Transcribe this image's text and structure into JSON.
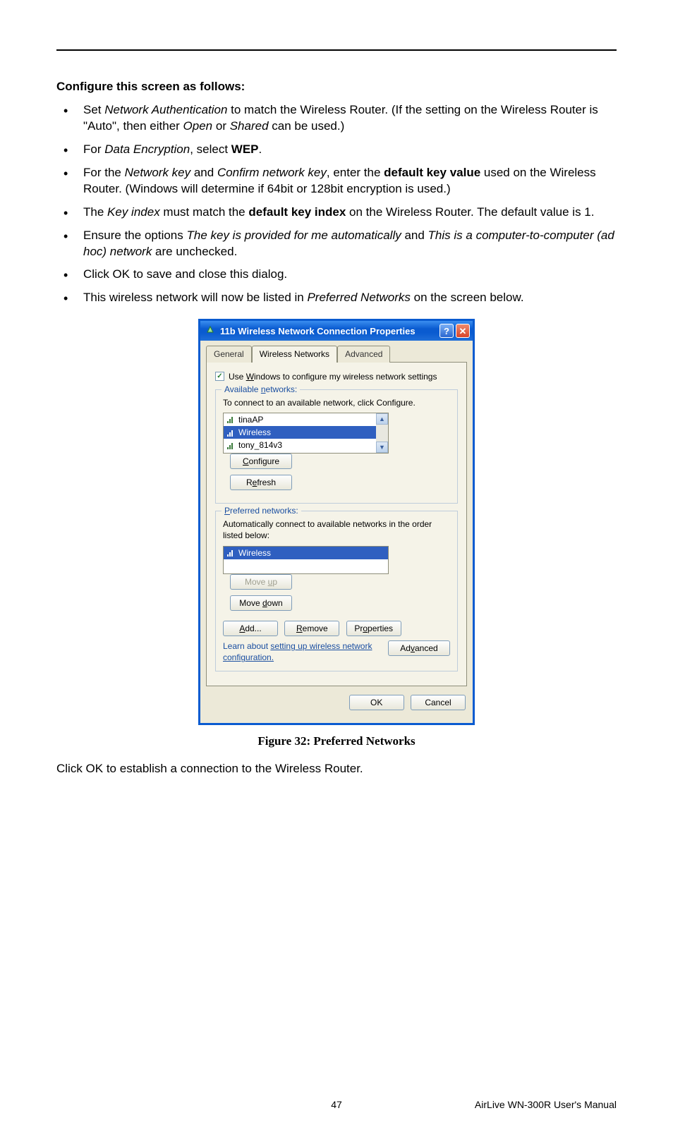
{
  "heading": "Configure this screen as follows:",
  "bullets": {
    "b1a": "Set ",
    "b1b": "Network Authentication",
    "b1c": " to match the Wireless Router. (If the setting on the Wireless Router is \"Auto\", then either ",
    "b1d": "Open",
    "b1e": " or ",
    "b1f": "Shared",
    "b1g": " can be used.)",
    "b2a": "For ",
    "b2b": "Data Encryption",
    "b2c": ", select ",
    "b2d": "WEP",
    "b2e": ".",
    "b3a": "For the ",
    "b3b": "Network key",
    "b3c": " and ",
    "b3d": "Confirm network key",
    "b3e": ", enter the ",
    "b3f": "default key value",
    "b3g": " used on the Wireless Router. (Windows will determine if 64bit or 128bit encryption is used.)",
    "b4a": "The ",
    "b4b": "Key index",
    "b4c": " must match the ",
    "b4d": "default key index",
    "b4e": " on the Wireless Router. The default value is 1.",
    "b5a": "Ensure the options ",
    "b5b": "The key is provided for me automatically",
    "b5c": " and ",
    "b5d": "This is a computer-to-computer (ad hoc) network",
    "b5e": " are unchecked.",
    "b6": "Click OK to save and close this dialog.",
    "b7a": "This wireless network will now be listed in ",
    "b7b": "Preferred Networks",
    "b7c": " on the screen below."
  },
  "dialog": {
    "title": "11b Wireless Network Connection Properties",
    "help_symbol": "?",
    "close_symbol": "✕",
    "tabs": {
      "general": "General",
      "wireless": "Wireless Networks",
      "advanced": "Advanced"
    },
    "checkbox_mark": "✓",
    "checkbox_pre": "Use ",
    "checkbox_u": "W",
    "checkbox_post": "indows to configure my wireless network settings",
    "available": {
      "legend_pre": "Available ",
      "legend_u": "n",
      "legend_post": "etworks:",
      "desc": "To connect to an available network, click Configure.",
      "items": [
        "tinaAP",
        "Wireless",
        "tony_814v3"
      ],
      "configure_u": "C",
      "configure_post": "onfigure",
      "refresh_pre": "R",
      "refresh_u": "e",
      "refresh_post": "fresh",
      "scroll_up": "▲",
      "scroll_down": "▼"
    },
    "preferred": {
      "legend_u": "P",
      "legend_post": "referred networks:",
      "desc": "Automatically connect to available networks in the order listed below:",
      "items": [
        "Wireless"
      ],
      "moveup_pre": "Move ",
      "moveup_u": "u",
      "moveup_post": "p",
      "movedown_pre": "Move ",
      "movedown_u": "d",
      "movedown_post": "own",
      "add_u": "A",
      "add_post": "dd...",
      "remove_u": "R",
      "remove_post": "emove",
      "props_pre": "Pr",
      "props_u": "o",
      "props_post": "perties"
    },
    "learn_pre": "Learn about ",
    "learn_link1": "setting up wireless network",
    "learn_link2": "configuration.",
    "advanced_btn_pre": "Ad",
    "advanced_btn_u": "v",
    "advanced_btn_post": "anced",
    "ok": "OK",
    "cancel": "Cancel"
  },
  "caption": "Figure 32: Preferred Networks",
  "after": "Click OK to establish a connection to the Wireless Router.",
  "footer": {
    "page": "47",
    "manual": "AirLive WN-300R User's Manual"
  }
}
